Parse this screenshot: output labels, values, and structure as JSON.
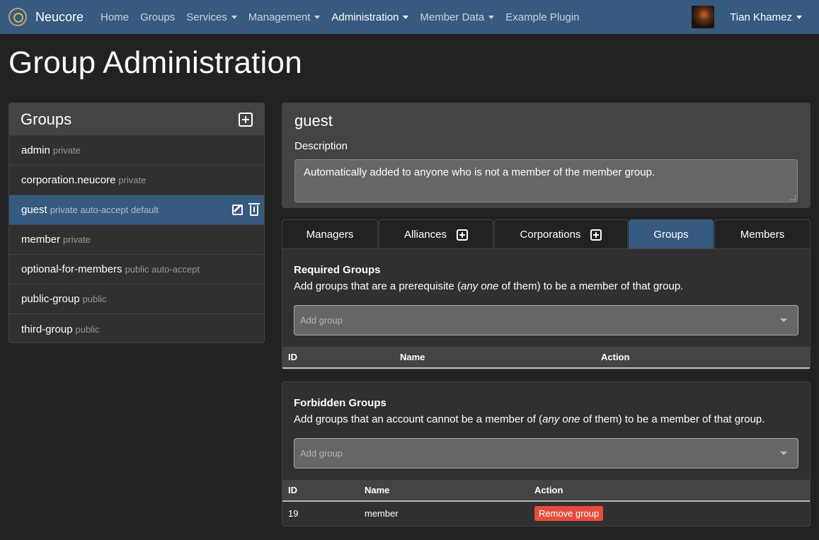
{
  "navbar": {
    "brand": "Neucore",
    "items": [
      {
        "label": "Home",
        "dropdown": false,
        "active": false
      },
      {
        "label": "Groups",
        "dropdown": false,
        "active": false
      },
      {
        "label": "Services",
        "dropdown": true,
        "active": false
      },
      {
        "label": "Management",
        "dropdown": true,
        "active": false
      },
      {
        "label": "Administration",
        "dropdown": true,
        "active": true
      },
      {
        "label": "Member Data",
        "dropdown": true,
        "active": false
      },
      {
        "label": "Example Plugin",
        "dropdown": false,
        "active": false
      }
    ],
    "user_name": "Tian Khamez"
  },
  "page_title": "Group Administration",
  "groups_panel": {
    "title": "Groups",
    "items": [
      {
        "name": "admin",
        "tags": "private"
      },
      {
        "name": "corporation.neucore",
        "tags": "private"
      },
      {
        "name": "guest",
        "tags": "private auto-accept default",
        "active": true
      },
      {
        "name": "member",
        "tags": "private"
      },
      {
        "name": "optional-for-members",
        "tags": "public auto-accept"
      },
      {
        "name": "public-group",
        "tags": "public"
      },
      {
        "name": "third-group",
        "tags": "public"
      }
    ]
  },
  "detail": {
    "title": "guest",
    "description_label": "Description",
    "description": "Automatically added to anyone who is not a member of the member group."
  },
  "tabs": [
    {
      "label": "Managers",
      "has_add": false,
      "active": false
    },
    {
      "label": "Alliances",
      "has_add": true,
      "active": false
    },
    {
      "label": "Corporations",
      "has_add": true,
      "active": false
    },
    {
      "label": "Groups",
      "has_add": false,
      "active": true
    },
    {
      "label": "Members",
      "has_add": false,
      "active": false
    }
  ],
  "required": {
    "title": "Required Groups",
    "text_before": "Add groups that are a prerequisite (",
    "text_em": "any one",
    "text_after": " of them) to be a member of that group.",
    "placeholder": "Add group",
    "columns": [
      "ID",
      "Name",
      "Action"
    ],
    "rows": []
  },
  "forbidden": {
    "title": "Forbidden Groups",
    "text_before": "Add groups that an account cannot be a member of (",
    "text_em": "any one",
    "text_after": " of them) to be a member of that group.",
    "placeholder": "Add group",
    "columns": [
      "ID",
      "Name",
      "Action"
    ],
    "rows": [
      {
        "id": "19",
        "name": "member",
        "action": "Remove group"
      }
    ]
  },
  "colors": {
    "navbar": "#375a7f",
    "background": "#222222",
    "danger": "#e74c3c"
  },
  "icons": [
    "neucore-logo-icon",
    "chevron-down-icon",
    "plus-square-icon",
    "edit-icon",
    "trash-icon"
  ]
}
